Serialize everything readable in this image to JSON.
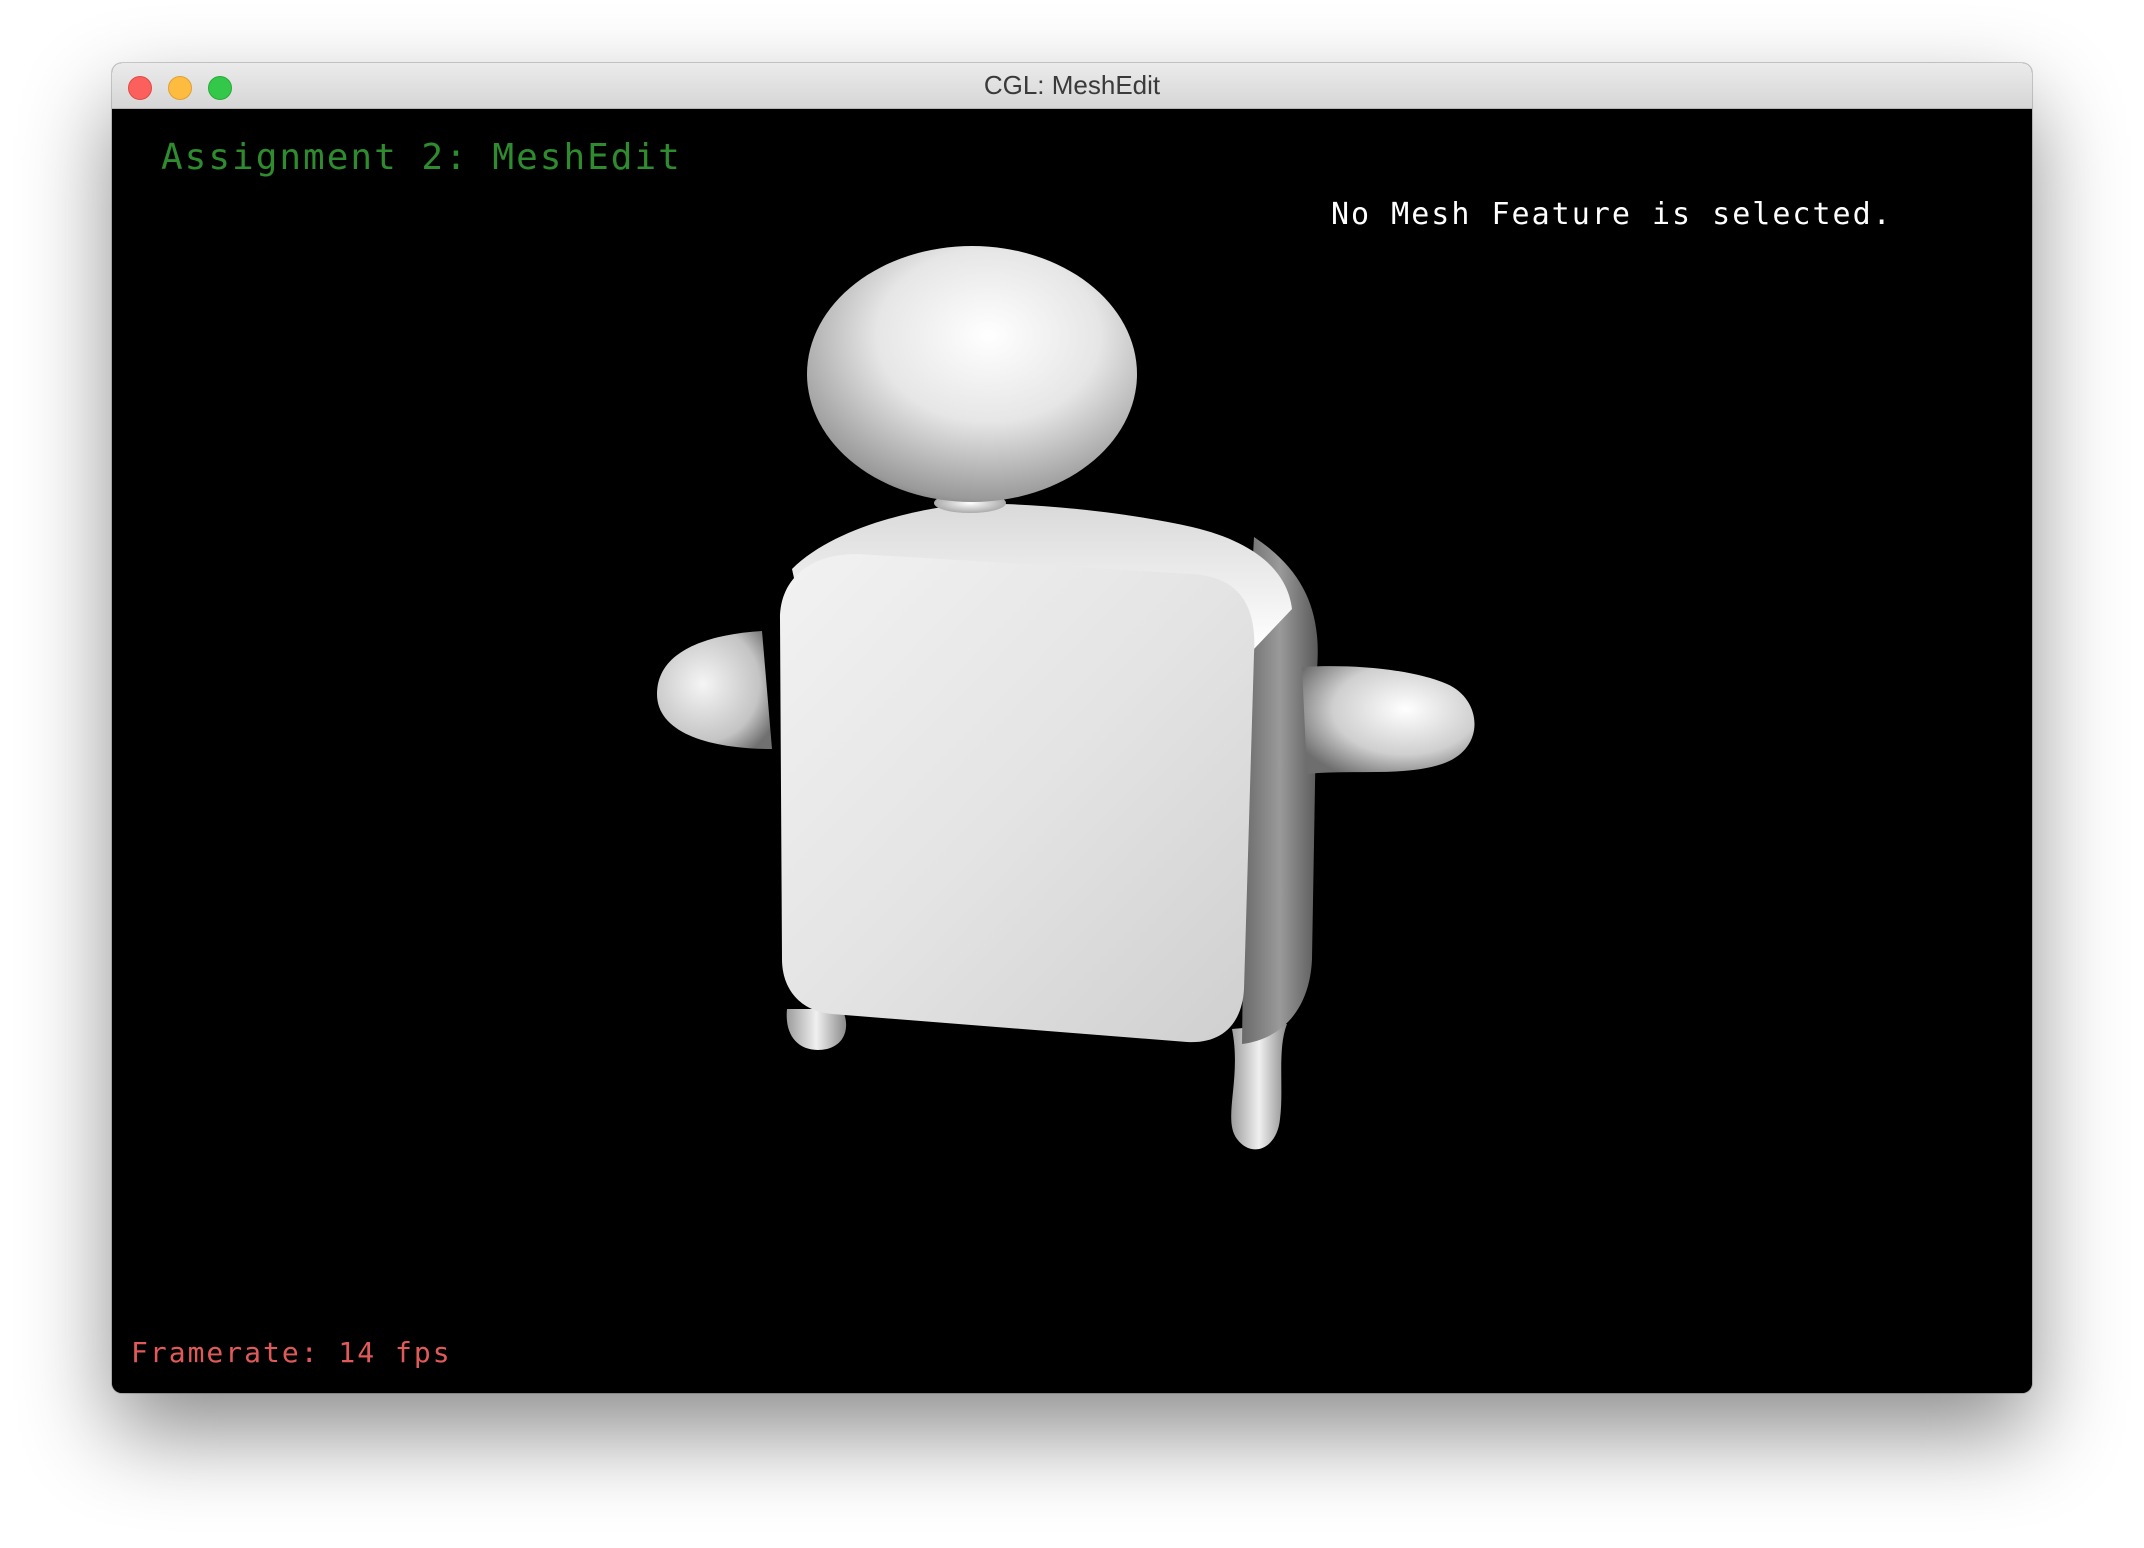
{
  "window": {
    "title": "CGL: MeshEdit"
  },
  "viewport": {
    "assignment_title": "Assignment 2: MeshEdit",
    "selection_info": "No Mesh Feature is selected.",
    "framerate_label": "Framerate: 14 fps",
    "framerate_fps": 14
  },
  "colors": {
    "assignment_title": "#2e8b2e",
    "selection_info": "#ffffff",
    "framerate": "#e05a5a",
    "background": "#000000"
  },
  "icons": {
    "close": "close-icon",
    "minimize": "minimize-icon",
    "zoom": "zoom-icon"
  }
}
